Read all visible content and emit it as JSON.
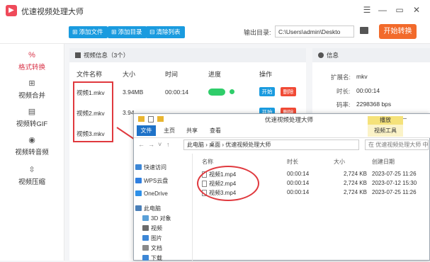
{
  "app": {
    "title": "优速视频处理大师",
    "logo_glyph": "▶",
    "window_controls": [
      "☰",
      "—",
      "▭",
      "✕"
    ]
  },
  "toolbar": {
    "add_file": "添加文件",
    "add_folder": "添加目录",
    "clear_list": "清除列表",
    "output_label": "输出目录:",
    "output_path": "C:\\Users\\admin\\Deskto",
    "start_convert": "开始转换"
  },
  "sidebar": {
    "items": [
      {
        "label": "格式转换",
        "icon": "%"
      },
      {
        "label": "视频合并",
        "icon": "⊞"
      },
      {
        "label": "视频转GIF",
        "icon": "▤"
      },
      {
        "label": "视频转音频",
        "icon": "◉"
      },
      {
        "label": "视频压缩",
        "icon": "⇳"
      }
    ]
  },
  "files_panel": {
    "header": "视频信息（3个）",
    "columns": [
      "文件名称",
      "大小",
      "时间",
      "进度",
      "操作"
    ],
    "rows": [
      {
        "name": "视频1.mkv",
        "size": "3.94MB",
        "time": "00:00:14",
        "start": "开始",
        "delete": "删除"
      },
      {
        "name": "视频2.mkv",
        "size": "3.94",
        "time": "",
        "start": "开始",
        "delete": "删除"
      },
      {
        "name": "视频3.mkv",
        "size": "",
        "time": "",
        "start": "",
        "delete": ""
      }
    ]
  },
  "info_panel": {
    "header": "信息",
    "ext_label": "扩展名:",
    "ext_value": "mkv",
    "duration_label": "时长:",
    "duration_value": "00:00:14",
    "bitrate_label": "码率:",
    "bitrate_value": "2298368 bps"
  },
  "explorer": {
    "title": "优速视频处理大师",
    "play_tab": "播放",
    "video_tools_tab": "视频工具",
    "tabs": [
      "文件",
      "主页",
      "共享",
      "查看"
    ],
    "breadcrumb": "此电脑 › 桌面 › 优速视频处理大师",
    "search_placeholder": "在 优速视频处理大师 中...",
    "tree": [
      "快速访问",
      "WPS云盘",
      "OneDrive",
      "此电脑",
      "3D 对象",
      "视频",
      "图片",
      "文档",
      "下载"
    ],
    "columns": [
      "名称",
      "时长",
      "大小",
      "创建日期"
    ],
    "files": [
      {
        "name": "视频1.mp4",
        "duration": "00:00:14",
        "size": "2,724 KB",
        "created": "2023-07-25 11:26"
      },
      {
        "name": "视频2.mp4",
        "duration": "00:00:14",
        "size": "2,724 KB",
        "created": "2023-07-12 15:30"
      },
      {
        "name": "视频3.mp4",
        "duration": "00:00:14",
        "size": "2,724 KB",
        "created": "2023-07-25 11:26"
      }
    ]
  },
  "colors": {
    "accent_blue": "#1a9bdf",
    "start_orange": "#f26a2b",
    "active_red": "#d9364a",
    "progress_green": "#2fcd6a",
    "delete_red": "#f04a35",
    "annotation_red": "#e0393e"
  }
}
